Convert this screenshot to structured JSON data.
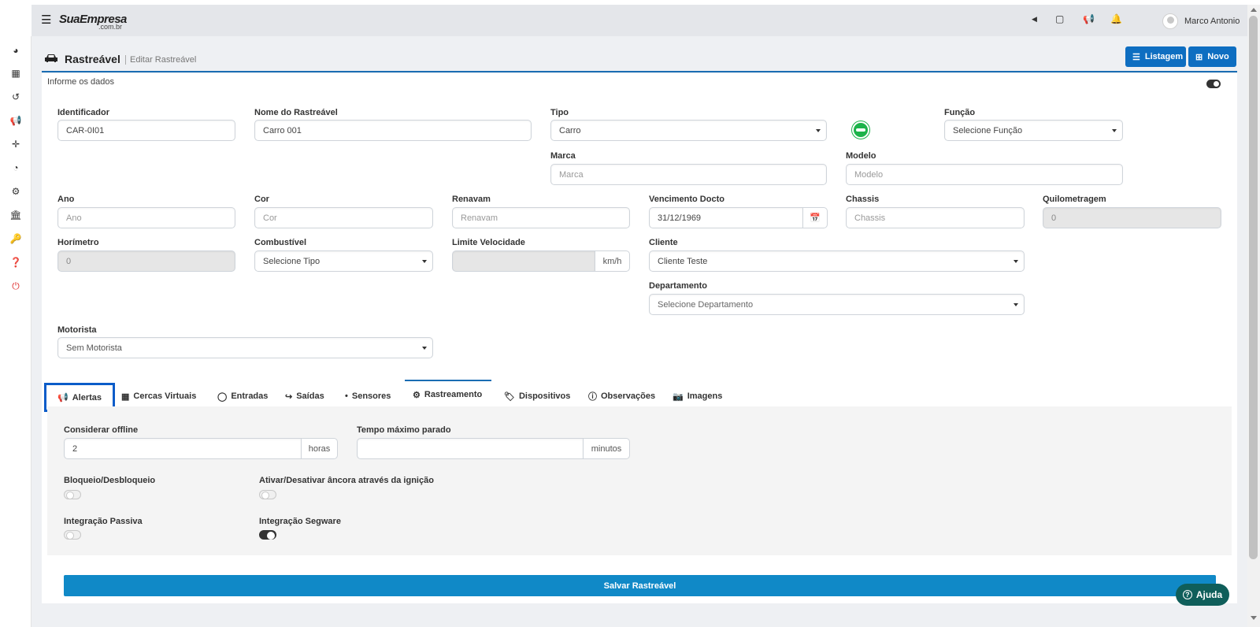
{
  "brand": {
    "name": "SuaEmpresa",
    "domain": ".com.br"
  },
  "topbar": {
    "icons": [
      "caret-left-icon",
      "monitor-icon",
      "megaphone-icon",
      "bell-icon"
    ],
    "user": "Marco Antonio"
  },
  "sidebar": {
    "icons": [
      "dashboard-icon",
      "map-icon",
      "history-icon",
      "megaphone-icon",
      "crosshair-icon",
      "pie-chart-icon",
      "cogs-icon",
      "bank-icon",
      "key-icon",
      "help-icon",
      "power-icon"
    ]
  },
  "header": {
    "title": "Rastreável",
    "subtitle": "Editar Rastreável",
    "listagem": "Listagem",
    "novo": "Novo"
  },
  "form": {
    "heading": "Informe os dados",
    "identificador": {
      "label": "Identificador",
      "value": "CAR-0I01"
    },
    "nome": {
      "label": "Nome do Rastreável",
      "value": "Carro 001"
    },
    "tipo": {
      "label": "Tipo",
      "value": "Carro"
    },
    "funcao": {
      "label": "Função",
      "value": "Selecione Função"
    },
    "marca": {
      "label": "Marca",
      "placeholder": "Marca"
    },
    "modelo": {
      "label": "Modelo",
      "placeholder": "Modelo"
    },
    "ano": {
      "label": "Ano",
      "placeholder": "Ano"
    },
    "cor": {
      "label": "Cor",
      "placeholder": "Cor"
    },
    "renavam": {
      "label": "Renavam",
      "placeholder": "Renavam"
    },
    "vencimento": {
      "label": "Vencimento Docto",
      "value": "31/12/1969"
    },
    "chassis": {
      "label": "Chassis",
      "placeholder": "Chassis"
    },
    "quilometragem": {
      "label": "Quilometragem",
      "value": "0"
    },
    "horimetro": {
      "label": "Horímetro",
      "value": "0"
    },
    "combustivel": {
      "label": "Combustível",
      "value": "Selecione Tipo"
    },
    "limite": {
      "label": "Limite Velocidade",
      "unit": "km/h"
    },
    "cliente": {
      "label": "Cliente",
      "value": "Cliente Teste"
    },
    "departamento": {
      "label": "Departamento",
      "value": "Selecione Departamento"
    },
    "motorista": {
      "label": "Motorista",
      "value": "Sem Motorista"
    }
  },
  "tabs": [
    {
      "label": "Alertas",
      "icon": "megaphone-icon"
    },
    {
      "label": "Cercas Virtuais",
      "icon": "fence-icon"
    },
    {
      "label": "Entradas",
      "icon": "lightbulb-icon"
    },
    {
      "label": "Saídas",
      "icon": "sign-out-icon"
    },
    {
      "label": "Sensores",
      "icon": "signal-icon"
    },
    {
      "label": "Rastreamento",
      "icon": "gear-icon"
    },
    {
      "label": "Dispositivos",
      "icon": "tags-icon"
    },
    {
      "label": "Observações",
      "icon": "info-icon"
    },
    {
      "label": "Imagens",
      "icon": "camera-icon"
    }
  ],
  "tracking": {
    "offline": {
      "label": "Considerar offline",
      "value": "2",
      "unit": "horas"
    },
    "parado": {
      "label": "Tempo máximo parado",
      "unit": "minutos"
    },
    "bloqueio": {
      "label": "Bloqueio/Desbloqueio",
      "on": false
    },
    "ancora": {
      "label": "Ativar/Desativar âncora através da ignição",
      "on": false
    },
    "passiva": {
      "label": "Integração Passiva",
      "on": false
    },
    "segware": {
      "label": "Integração Segware",
      "on": true
    }
  },
  "actions": {
    "save": "Salvar Rastreável",
    "help": "Ajuda"
  }
}
